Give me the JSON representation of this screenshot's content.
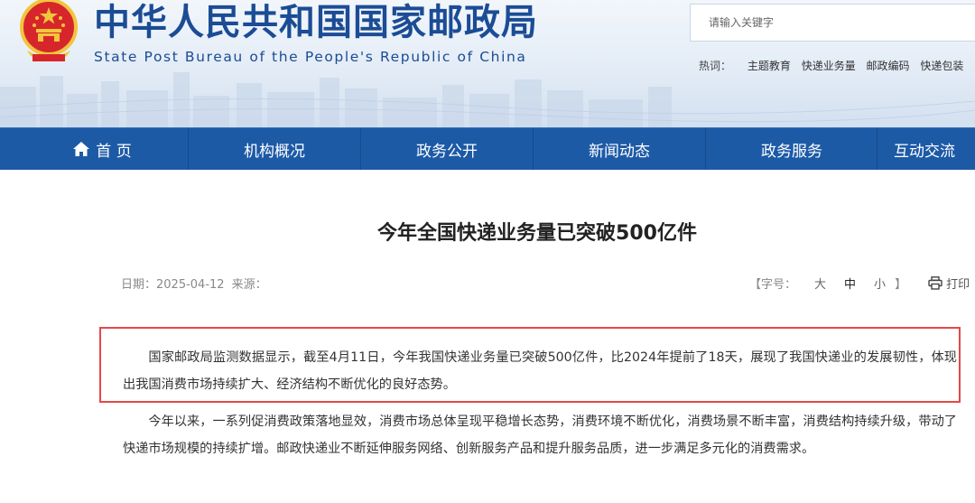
{
  "header": {
    "title_cn": "中华人民共和国国家邮政局",
    "title_en": "State Post Bureau of the People's Republic of China",
    "search": {
      "placeholder": "请输入关键字"
    },
    "hotwords": {
      "label": "热词：",
      "items": [
        "主题教育",
        "快递业务量",
        "邮政编码",
        "快递包装"
      ]
    }
  },
  "nav": {
    "items": [
      {
        "label": "首 页",
        "icon": "home-icon"
      },
      {
        "label": "机构概况"
      },
      {
        "label": "政务公开"
      },
      {
        "label": "新闻动态"
      },
      {
        "label": "政务服务"
      },
      {
        "label": "互动交流"
      }
    ]
  },
  "article": {
    "title": "今年全国快递业务量已突破500亿件",
    "date_label": "日期：",
    "date": "2025-04-12",
    "source_label": "来源：",
    "font_size_label": "【字号：",
    "font_sizes": [
      "大",
      "中",
      "小"
    ],
    "font_size_close": "】",
    "print_label": "打印",
    "paragraphs": [
      "国家邮政局监测数据显示，截至4月11日，今年我国快递业务量已突破500亿件，比2024年提前了18天，展现了我国快递业的发展韧性，体现出我国消费市场持续扩大、经济结构不断优化的良好态势。",
      "今年以来，一系列促消费政策落地显效，消费市场总体呈现平稳增长态势，消费环境不断优化，消费场景不断丰富，消费结构持续升级，带动了快递市场规模的持续扩增。邮政快递业不断延伸服务网络、创新服务产品和提升服务品质，进一步满足多元化的消费需求。"
    ]
  },
  "colors": {
    "brand_blue": "#1b4c95",
    "nav_blue": "#1d5aa6",
    "highlight_red": "#e54848",
    "emblem_red": "#d7262b",
    "emblem_gold": "#f2c53d"
  }
}
